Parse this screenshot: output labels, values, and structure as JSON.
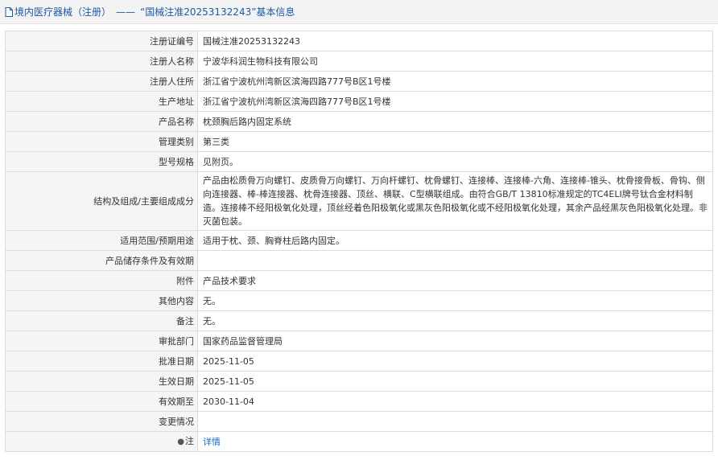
{
  "header": {
    "category": "境内医疗器械（注册）",
    "separator": "——",
    "title": "“国械注准20253132243”基本信息"
  },
  "rows": [
    {
      "label": "注册证编号",
      "value": "国械注准20253132243"
    },
    {
      "label": "注册人名称",
      "value": "宁波华科润生物科技有限公司"
    },
    {
      "label": "注册人住所",
      "value": "浙江省宁波杭州湾新区滨海四路777号B区1号楼"
    },
    {
      "label": "生产地址",
      "value": "浙江省宁波杭州湾新区滨海四路777号B区1号楼"
    },
    {
      "label": "产品名称",
      "value": "枕颈胸后路内固定系统"
    },
    {
      "label": "管理类别",
      "value": "第三类"
    },
    {
      "label": "型号规格",
      "value": "见附页。"
    },
    {
      "label": "结构及组成/主要组成成分",
      "value": "产品由松质骨万向螺钉、皮质骨万向螺钉、万向杆螺钉、枕骨螺钉、连接棒、连接棒-六角、连接棒-锥头、枕骨接骨板、骨钩、侧向连接器、棒-棒连接器、枕骨连接器、顶丝、横联、C型横联组成。由符合GB/T 13810标准规定的TC4ELI牌号钛合金材料制造。连接棒不经阳极氧化处理，顶丝经着色阳极氧化或黑灰色阳极氧化或不经阳极氧化处理，其余产品经黑灰色阳极氧化处理。非灭菌包装。"
    },
    {
      "label": "适用范围/预期用途",
      "value": "适用于枕、颈、胸脊柱后路内固定。"
    },
    {
      "label": "产品储存条件及有效期",
      "value": ""
    },
    {
      "label": "附件",
      "value": "产品技术要求"
    },
    {
      "label": "其他内容",
      "value": "无。"
    },
    {
      "label": "备注",
      "value": "无。"
    },
    {
      "label": "审批部门",
      "value": "国家药品监督管理局"
    },
    {
      "label": "批准日期",
      "value": "2025-11-05"
    },
    {
      "label": "生效日期",
      "value": "2025-11-05"
    },
    {
      "label": "有效期至",
      "value": "2030-11-04"
    },
    {
      "label": "变更情况",
      "value": ""
    }
  ],
  "note": {
    "label": "注",
    "link": "详情"
  }
}
